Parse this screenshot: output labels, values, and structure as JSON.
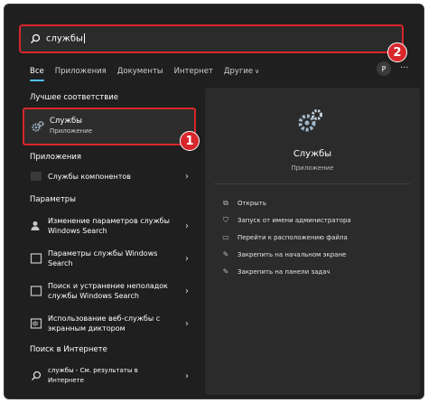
{
  "search": {
    "value": "службы"
  },
  "tabs": [
    {
      "label": "Все"
    },
    {
      "label": "Приложения"
    },
    {
      "label": "Документы"
    },
    {
      "label": "Интернет"
    },
    {
      "label": "Другие"
    }
  ],
  "avatar": "P",
  "best_match": {
    "heading": "Лучшее соответствие",
    "title": "Службы",
    "subtitle": "Приложение"
  },
  "apps": {
    "heading": "Приложения",
    "items": [
      {
        "label": "Службы компонентов"
      }
    ]
  },
  "settings": {
    "heading": "Параметры",
    "items": [
      {
        "line1": "Изменение параметров службы",
        "line2": "Windows Search"
      },
      {
        "line1": "Параметры службы Windows",
        "line2": "Search"
      },
      {
        "line1": "Поиск и устранение неполадок",
        "line2": "службы Windows Search"
      },
      {
        "line1": "Использование веб-службы с",
        "line2": "экранным диктором"
      }
    ]
  },
  "web": {
    "heading": "Поиск в Интернете",
    "line1": "службы - См. результаты в",
    "line2": "Интернете"
  },
  "preview": {
    "title": "Службы",
    "subtitle": "Приложение",
    "actions": [
      {
        "label": "Открыть",
        "icon": "open-icon"
      },
      {
        "label": "Запуск от имени администратора",
        "icon": "shield-icon"
      },
      {
        "label": "Перейти к расположению файла",
        "icon": "folder-icon"
      },
      {
        "label": "Закрепить на начальном экране",
        "icon": "pin-icon"
      },
      {
        "label": "Закрепить на панели задач",
        "icon": "pin-icon"
      }
    ]
  },
  "badges": [
    "1",
    "2"
  ],
  "colors": {
    "accent": "#4cc2ff",
    "highlight": "#d8262b",
    "background": "#1f1f1f",
    "panel": "#2b2b2b"
  }
}
